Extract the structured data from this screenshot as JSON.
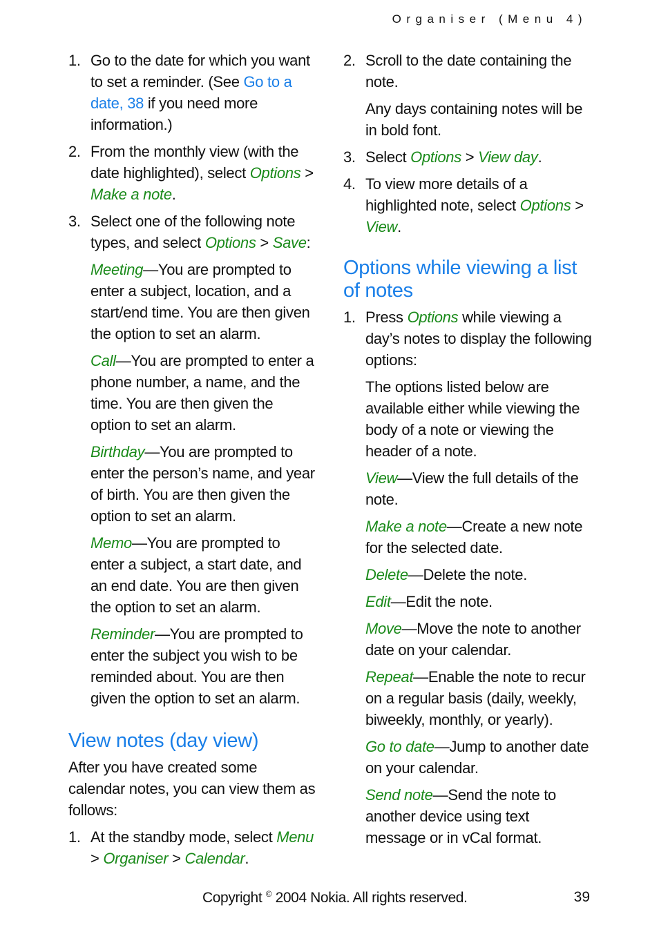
{
  "header": {
    "running_head": "Organiser (Menu 4)"
  },
  "left": {
    "steps": [
      {
        "num": "1.",
        "parts": [
          "Go to the date for which you want to set a reminder. (See ",
          "Go to a date, 38",
          " if you need more information.)"
        ]
      },
      {
        "num": "2.",
        "parts": [
          "From the monthly view (with the date highlighted), select ",
          "Options",
          " > ",
          "Make a note",
          "."
        ]
      },
      {
        "num": "3.",
        "parts": [
          "Select one of the following note types, and select ",
          "Options",
          " > ",
          "Save",
          ":"
        ]
      }
    ],
    "note_types": [
      {
        "term": "Meeting",
        "desc": "—You are prompted to enter a subject, location, and a start/end time. You are then given the option to set an alarm."
      },
      {
        "term": "Call",
        "desc": "—You are prompted to enter a phone number, a name, and the time. You are then given the option to set an alarm."
      },
      {
        "term": "Birthday",
        "desc": "—You are prompted to enter the person’s name, and year of birth. You are then given the option to set an alarm."
      },
      {
        "term": "Memo",
        "desc": "—You are prompted to enter a subject, a start date, and an end date. You are then given the option to set an alarm."
      },
      {
        "term": "Reminder",
        "desc": "—You are prompted to enter the subject you wish to be reminded about. You are then given the option to set an alarm."
      }
    ],
    "section_title": "View notes (day view)",
    "section_intro": "After you have created some calendar notes, you can view them as follows:",
    "section_step1": {
      "num": "1.",
      "text": "At the standby mode, select ",
      "menu": "Menu",
      "sep": " > ",
      "organiser": "Organiser",
      "calendar": "Calendar",
      "end": "."
    }
  },
  "right": {
    "step2": {
      "num": "2.",
      "text": "Scroll to the date containing the note."
    },
    "step2_note": "Any days containing notes will be in bold font.",
    "step3": {
      "num": "3.",
      "text": "Select ",
      "a": "Options",
      "sep": " > ",
      "b": "View day",
      "end": "."
    },
    "step4": {
      "num": "4.",
      "text": "To view more details of a highlighted note, select ",
      "a": "Options",
      "sep": " > ",
      "b": "View",
      "end": "."
    },
    "section_title": "Options while viewing a list of notes",
    "s_step1": {
      "num": "1.",
      "pre": "Press ",
      "a": "Options",
      "post": " while viewing a day’s notes to display the following options:"
    },
    "s_note": "The options listed below are available either while viewing the body of a note or viewing the header of a note.",
    "options": [
      {
        "term": "View",
        "desc": "—View the full details of the note."
      },
      {
        "term": "Make a note",
        "desc": "—Create a new note for the selected date."
      },
      {
        "term": "Delete",
        "desc": "—Delete the note."
      },
      {
        "term": "Edit",
        "desc": "—Edit the note."
      },
      {
        "term": "Move",
        "desc": "—Move the note to another date on your calendar."
      },
      {
        "term": "Repeat",
        "desc": "—Enable the note to recur on a regular basis (daily, weekly, biweekly, monthly, or yearly)."
      },
      {
        "term": "Go to date",
        "desc": "—Jump to another date on your calendar."
      },
      {
        "term": "Send note",
        "desc": "—Send the note to another device using text message or in vCal format."
      }
    ]
  },
  "footer": {
    "copyright_pre": "Copyright ",
    "copyright_symbol": "©",
    "copyright_post": " 2004 Nokia. All rights reserved.",
    "page_number": "39"
  }
}
